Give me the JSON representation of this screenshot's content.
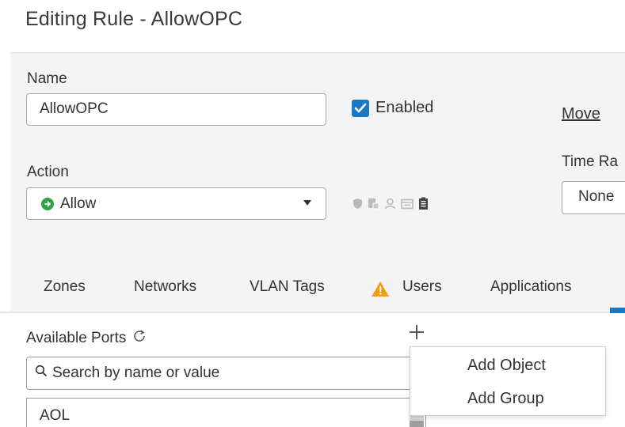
{
  "page": {
    "title": "Editing Rule - AllowOPC"
  },
  "form": {
    "name_label": "Name",
    "name_value": "AllowOPC",
    "enabled_label": "Enabled",
    "enabled_checked": true,
    "move_label": "Move",
    "action_label": "Action",
    "action_value": "Allow",
    "time_range_label": "Time Ra",
    "time_range_value": "None",
    "action_icons": [
      "shield-icon",
      "file-icon",
      "user-icon",
      "window-icon",
      "clipboard-icon"
    ]
  },
  "tabs": [
    {
      "label": "Zones"
    },
    {
      "label": "Networks"
    },
    {
      "label": "VLAN Tags"
    },
    {
      "label": "Users",
      "warning": true
    },
    {
      "label": "Applications"
    }
  ],
  "ports": {
    "available_label": "Available Ports",
    "search_placeholder": "Search by name or value",
    "items": [
      "AOL"
    ]
  },
  "add_menu": {
    "items": [
      "Add Object",
      "Add Group"
    ]
  },
  "colors": {
    "accent": "#1a79c2",
    "allow_green": "#2ea446",
    "warning_orange": "#f39c12"
  }
}
